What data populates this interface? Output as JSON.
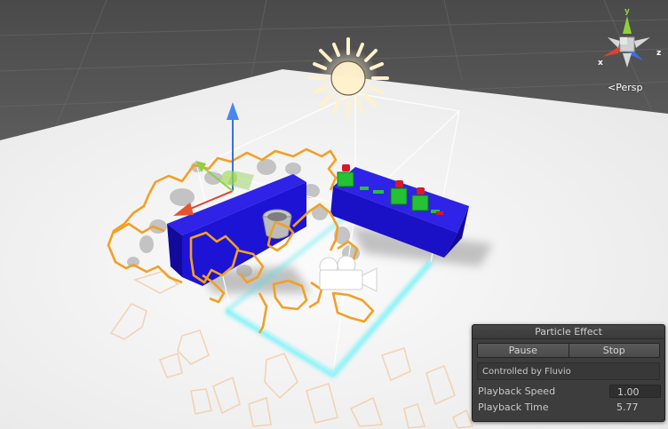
{
  "scene_view": {
    "projection_label": "Persp",
    "gizmo": {
      "y_label": "y",
      "x_label": "x",
      "z_label": "z",
      "x_color": "#e0412e",
      "y_color": "#8fd13b",
      "z_color": "#3a6fe0"
    },
    "icons": [
      "sun-light-icon",
      "camera-icon",
      "move-gizmo-icon"
    ]
  },
  "particle_panel": {
    "title": "Particle Effect",
    "pause_label": "Pause",
    "stop_label": "Stop",
    "controlled_by": "Controlled by Fluvio",
    "playback_speed_label": "Playback Speed",
    "playback_speed_value": "1.00",
    "playback_time_label": "Playback Time",
    "playback_time_value": "5.77"
  },
  "colors": {
    "outline_orange": "#f2a024",
    "mesh_blue": "#1d13d4",
    "selection_cyan": "#33e9f2",
    "ground": "#f4f4f4"
  }
}
